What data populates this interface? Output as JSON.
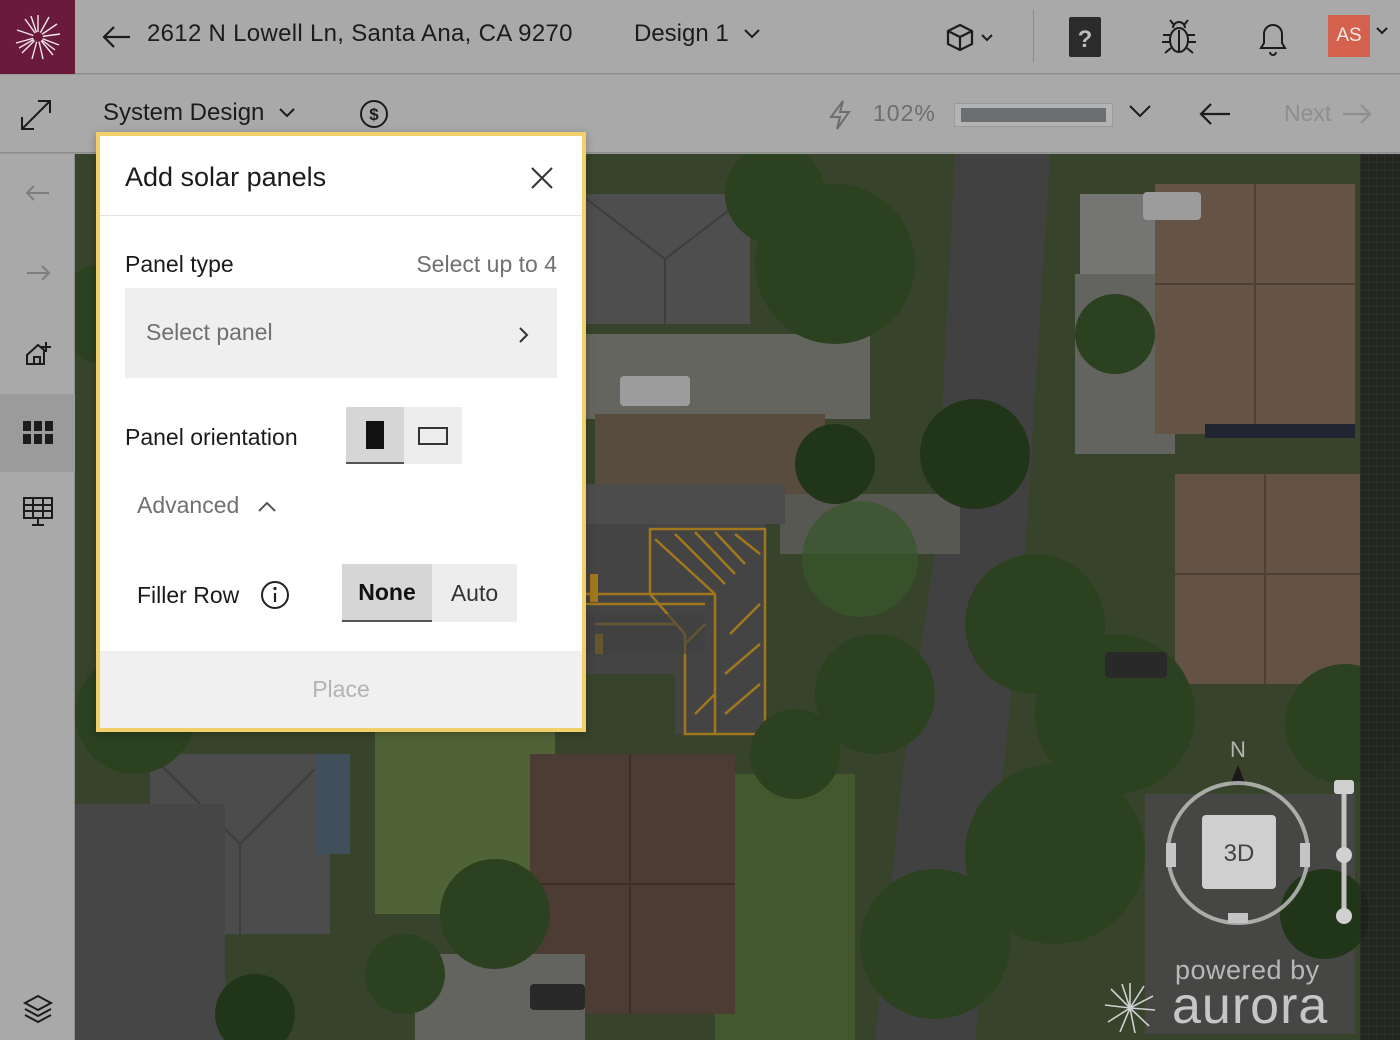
{
  "header": {
    "address": "2612 N Lowell Ln, Santa Ana, CA 9270",
    "design_name": "Design 1",
    "avatar_initials": "AS"
  },
  "toolbar": {
    "mode_label": "System Design",
    "efficiency": "102%",
    "efficiency_progress": 1.0,
    "next_label": "Next"
  },
  "modal": {
    "title": "Add solar panels",
    "panel_type_label": "Panel type",
    "panel_type_hint": "Select up to 4",
    "select_placeholder": "Select panel",
    "orientation_label": "Panel orientation",
    "advanced_label": "Advanced",
    "filler_row_label": "Filler Row",
    "filler_options": [
      "None",
      "Auto"
    ],
    "filler_selected": "None",
    "place_label": "Place"
  },
  "map": {
    "compass_north": "N",
    "view_mode": "3D",
    "powered_by": "powered by",
    "brand": "aurora"
  },
  "colors": {
    "brand_bg": "#6a1b3c",
    "avatar_bg": "#d3614e",
    "modal_border": "#f1cf6a",
    "roof_highlight": "#e0a62a"
  }
}
